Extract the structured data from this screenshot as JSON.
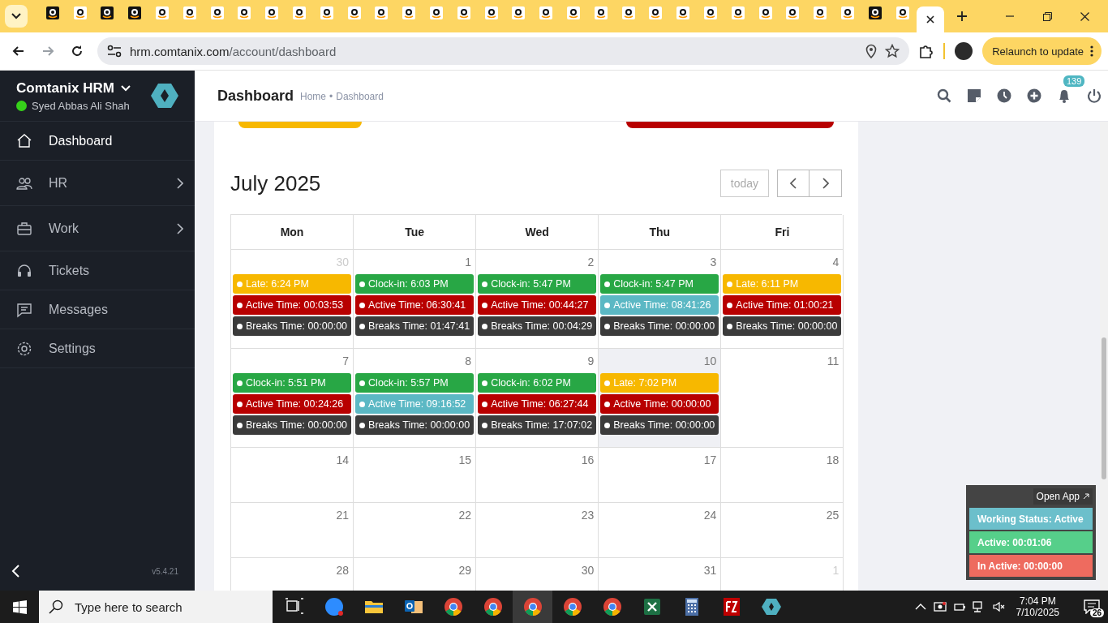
{
  "browser": {
    "tabs": [
      {
        "kind": "dark",
        "selected": false
      },
      {
        "kind": "light",
        "selected": false
      },
      {
        "kind": "dark",
        "selected": false
      },
      {
        "kind": "dark",
        "selected": false
      },
      {
        "kind": "light",
        "selected": false
      },
      {
        "kind": "light",
        "selected": false
      },
      {
        "kind": "light",
        "selected": false
      },
      {
        "kind": "light",
        "selected": false
      },
      {
        "kind": "light",
        "selected": false
      },
      {
        "kind": "light",
        "selected": false
      },
      {
        "kind": "light",
        "selected": false
      },
      {
        "kind": "light",
        "selected": false
      },
      {
        "kind": "light",
        "selected": false
      },
      {
        "kind": "light",
        "selected": false
      },
      {
        "kind": "light",
        "selected": false
      },
      {
        "kind": "light",
        "selected": false
      },
      {
        "kind": "light",
        "selected": false
      },
      {
        "kind": "light",
        "selected": false
      },
      {
        "kind": "light",
        "selected": false
      },
      {
        "kind": "light",
        "selected": false
      },
      {
        "kind": "light",
        "selected": false
      },
      {
        "kind": "light",
        "selected": false
      },
      {
        "kind": "light",
        "selected": false
      },
      {
        "kind": "light",
        "selected": false
      },
      {
        "kind": "light",
        "selected": false
      },
      {
        "kind": "light",
        "selected": false
      },
      {
        "kind": "light",
        "selected": false
      },
      {
        "kind": "light",
        "selected": false
      },
      {
        "kind": "light",
        "selected": false
      },
      {
        "kind": "light",
        "selected": false
      },
      {
        "kind": "dark",
        "selected": false
      },
      {
        "kind": "light",
        "selected": false
      },
      {
        "kind": "blank",
        "selected": true
      }
    ],
    "url_host": "hrm.comtanix.com",
    "url_path": "/account/dashboard",
    "relaunch": "Relaunch to update"
  },
  "sidebar": {
    "brand": "Comtanix HRM",
    "user": "Syed Abbas Ali Shah",
    "online": true,
    "items": [
      {
        "label": "Dashboard",
        "selected": true,
        "has_submenu": false
      },
      {
        "label": "HR",
        "selected": false,
        "has_submenu": true
      },
      {
        "label": "Work",
        "selected": false,
        "has_submenu": true
      },
      {
        "label": "Tickets",
        "selected": false,
        "has_submenu": false
      },
      {
        "label": "Messages",
        "selected": false,
        "has_submenu": false
      },
      {
        "label": "Settings",
        "selected": false,
        "has_submenu": false
      }
    ],
    "version": "v5.4.21"
  },
  "header": {
    "title": "Dashboard",
    "breadcrumb": [
      "Home",
      "Dashboard"
    ],
    "breadcrumb_separator": "•",
    "notification_count": "139"
  },
  "calendar": {
    "title": "July 2025",
    "today_button": "today",
    "columns": [
      "Mon",
      "Tue",
      "Wed",
      "Thu",
      "Fri"
    ],
    "weeks": [
      {
        "cells": [
          {
            "day": "30",
            "other_month": true,
            "today": false,
            "events": [
              {
                "label": "Late: 6:24 PM",
                "color": "#f7b800"
              },
              {
                "label": "Active Time: 00:03:53",
                "color": "#b80000"
              },
              {
                "label": "Breaks Time: 00:00:00",
                "color": "#3b3b3b"
              }
            ]
          },
          {
            "day": "1",
            "other_month": false,
            "today": false,
            "events": [
              {
                "label": "Clock-in: 6:03 PM",
                "color": "#28a745"
              },
              {
                "label": "Active Time: 06:30:41",
                "color": "#b80000"
              },
              {
                "label": "Breaks Time: 01:47:41",
                "color": "#3b3b3b"
              }
            ]
          },
          {
            "day": "2",
            "other_month": false,
            "today": false,
            "events": [
              {
                "label": "Clock-in: 5:47 PM",
                "color": "#28a745"
              },
              {
                "label": "Active Time: 00:44:27",
                "color": "#b80000"
              },
              {
                "label": "Breaks Time: 00:04:29",
                "color": "#3b3b3b"
              }
            ]
          },
          {
            "day": "3",
            "other_month": false,
            "today": false,
            "events": [
              {
                "label": "Clock-in: 5:47 PM",
                "color": "#28a745"
              },
              {
                "label": "Active Time: 08:41:26",
                "color": "#5bb8c4"
              },
              {
                "label": "Breaks Time: 00:00:00",
                "color": "#3b3b3b"
              }
            ]
          },
          {
            "day": "4",
            "other_month": false,
            "today": false,
            "events": [
              {
                "label": "Late: 6:11 PM",
                "color": "#f7b800"
              },
              {
                "label": "Active Time: 01:00:21",
                "color": "#b80000"
              },
              {
                "label": "Breaks Time: 00:00:00",
                "color": "#3b3b3b"
              }
            ]
          }
        ]
      },
      {
        "cells": [
          {
            "day": "7",
            "other_month": false,
            "today": false,
            "events": [
              {
                "label": "Clock-in: 5:51 PM",
                "color": "#28a745"
              },
              {
                "label": "Active Time: 00:24:26",
                "color": "#b80000"
              },
              {
                "label": "Breaks Time: 00:00:00",
                "color": "#3b3b3b"
              }
            ]
          },
          {
            "day": "8",
            "other_month": false,
            "today": false,
            "events": [
              {
                "label": "Clock-in: 5:57 PM",
                "color": "#28a745"
              },
              {
                "label": "Active Time: 09:16:52",
                "color": "#5bb8c4"
              },
              {
                "label": "Breaks Time: 00:00:00",
                "color": "#3b3b3b"
              }
            ]
          },
          {
            "day": "9",
            "other_month": false,
            "today": false,
            "events": [
              {
                "label": "Clock-in: 6:02 PM",
                "color": "#28a745"
              },
              {
                "label": "Active Time: 06:27:44",
                "color": "#b80000"
              },
              {
                "label": "Breaks Time: 17:07:02",
                "color": "#3b3b3b"
              }
            ]
          },
          {
            "day": "10",
            "other_month": false,
            "today": true,
            "events": [
              {
                "label": "Late: 7:02 PM",
                "color": "#f7b800"
              },
              {
                "label": "Active Time: 00:00:00",
                "color": "#b80000"
              },
              {
                "label": "Breaks Time: 00:00:00",
                "color": "#3b3b3b"
              }
            ]
          },
          {
            "day": "11",
            "other_month": false,
            "today": false
          }
        ]
      },
      {
        "cells": [
          {
            "day": "14",
            "other_month": false,
            "today": false
          },
          {
            "day": "15",
            "other_month": false,
            "today": false
          },
          {
            "day": "16",
            "other_month": false,
            "today": false
          },
          {
            "day": "17",
            "other_month": false,
            "today": false
          },
          {
            "day": "18",
            "other_month": false,
            "today": false
          }
        ]
      },
      {
        "cells": [
          {
            "day": "21",
            "other_month": false,
            "today": false
          },
          {
            "day": "22",
            "other_month": false,
            "today": false
          },
          {
            "day": "23",
            "other_month": false,
            "today": false
          },
          {
            "day": "24",
            "other_month": false,
            "today": false
          },
          {
            "day": "25",
            "other_month": false,
            "today": false
          }
        ]
      },
      {
        "cells": [
          {
            "day": "28",
            "other_month": false,
            "today": false
          },
          {
            "day": "29",
            "other_month": false,
            "today": false
          },
          {
            "day": "30",
            "other_month": false,
            "today": false
          },
          {
            "day": "31",
            "other_month": false,
            "today": false
          },
          {
            "day": "1",
            "other_month": true,
            "today": false
          }
        ]
      }
    ]
  },
  "tracker": {
    "open_app": "Open App",
    "rows": [
      {
        "label": "Working Status: Active",
        "color": "#6cbfcb"
      },
      {
        "label": "Active: 00:01:06",
        "color": "#56cf8a"
      },
      {
        "label": "In Active: 00:00:00",
        "color": "#ee6b5f"
      }
    ]
  },
  "taskbar": {
    "search_placeholder": "Type here to search",
    "apps": [
      {
        "kind": "taskview",
        "selected": false
      },
      {
        "kind": "zoom",
        "selected": false
      },
      {
        "kind": "folder",
        "selected": false
      },
      {
        "kind": "outlook",
        "selected": false
      },
      {
        "kind": "chrome",
        "selected": false
      },
      {
        "kind": "chrome",
        "selected": false
      },
      {
        "kind": "chrome",
        "selected": true
      },
      {
        "kind": "chrome",
        "selected": false
      },
      {
        "kind": "chrome",
        "selected": false
      },
      {
        "kind": "excel",
        "selected": false
      },
      {
        "kind": "calculator",
        "selected": false
      },
      {
        "kind": "filezilla",
        "selected": false
      },
      {
        "kind": "hexagon",
        "selected": false
      }
    ],
    "time": "7:04 PM",
    "date": "7/10/2025",
    "notifications": "26"
  }
}
